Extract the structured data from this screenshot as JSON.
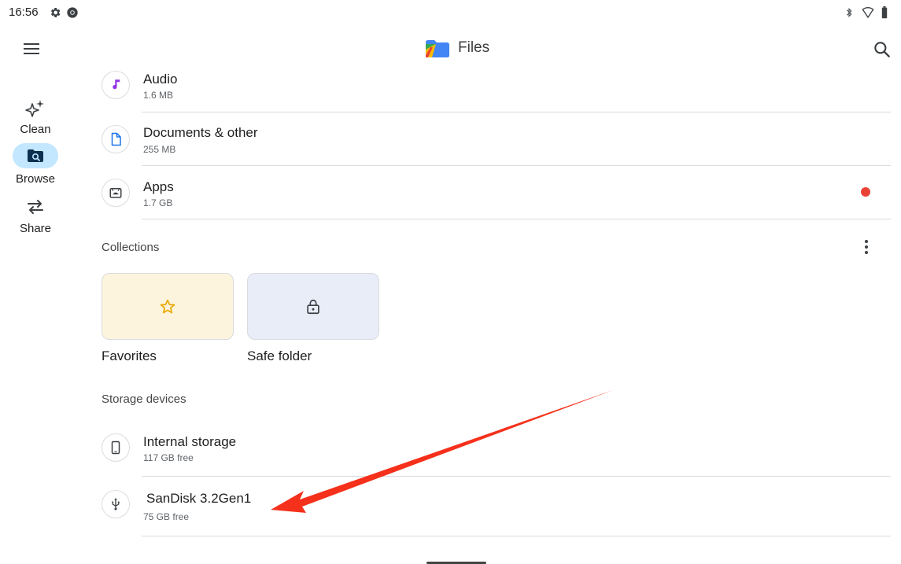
{
  "status_bar": {
    "time": "16:56",
    "left_icons": [
      "settings-icon",
      "chrome-icon"
    ],
    "right_icons": [
      "bluetooth-icon",
      "wifi-icon",
      "battery-icon"
    ]
  },
  "app_bar": {
    "title": "Files",
    "menu_icon": "hamburger-menu-icon",
    "search_icon": "search-icon"
  },
  "nav_rail": {
    "items": [
      {
        "label": "Clean",
        "icon": "sparkle-icon",
        "selected": false
      },
      {
        "label": "Browse",
        "icon": "folder-search-icon",
        "selected": true
      },
      {
        "label": "Share",
        "icon": "swap-arrows-icon",
        "selected": false
      }
    ],
    "selected_color": "#c2e7ff"
  },
  "categories": [
    {
      "title": "Audio",
      "subtitle": "1.6 MB",
      "icon": "music-note-icon",
      "icon_color": "#9334e6"
    },
    {
      "title": "Documents & other",
      "subtitle": "255 MB",
      "icon": "document-icon",
      "icon_color": "#1a73e8"
    },
    {
      "title": "Apps",
      "subtitle": "1.7 GB",
      "icon": "android-icon",
      "icon_color": "#3c4043",
      "has_notification": true
    }
  ],
  "collections": {
    "title": "Collections",
    "more_icon": "more-vert-icon",
    "tiles": [
      {
        "label": "Favorites",
        "icon": "star-icon",
        "bg": "#fcf4dc",
        "icon_color": "#e8a600"
      },
      {
        "label": "Safe folder",
        "icon": "lock-icon",
        "bg": "#e8edf8",
        "icon_color": "#3c4043"
      }
    ]
  },
  "storage": {
    "title": "Storage devices",
    "devices": [
      {
        "title": "Internal storage",
        "subtitle": "117 GB free",
        "icon": "phone-icon"
      },
      {
        "title": "SanDisk 3.2Gen1",
        "subtitle": "75 GB free",
        "icon": "usb-icon"
      }
    ]
  },
  "colors": {
    "accent_dot": "#e94235",
    "annotation_arrow": "#f5301b"
  }
}
